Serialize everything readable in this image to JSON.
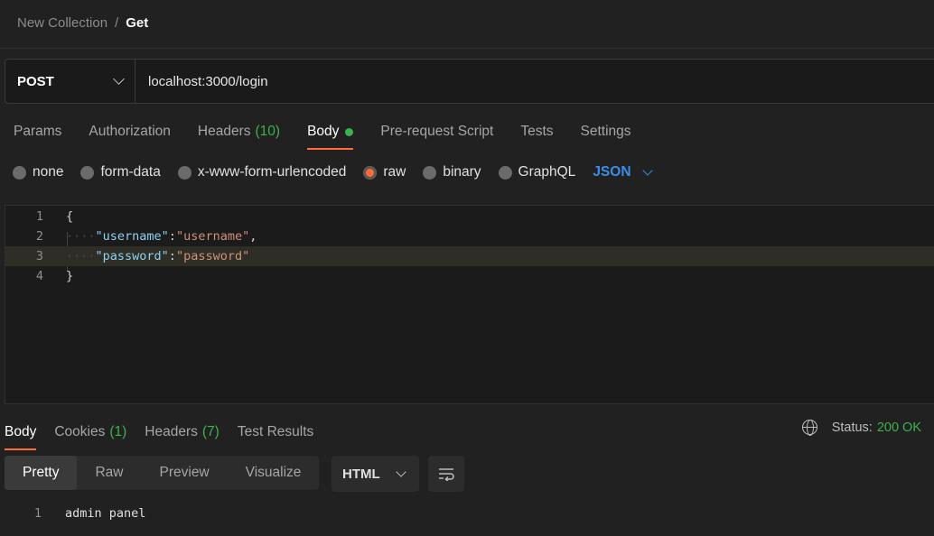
{
  "breadcrumb": {
    "parent": "New Collection",
    "separator": "/",
    "current": "Get"
  },
  "request": {
    "method": "POST",
    "url": "localhost:3000/login"
  },
  "request_tabs": [
    {
      "label": "Params"
    },
    {
      "label": "Authorization"
    },
    {
      "label": "Headers",
      "count": "(10)"
    },
    {
      "label": "Body",
      "active": true
    },
    {
      "label": "Pre-request Script"
    },
    {
      "label": "Tests"
    },
    {
      "label": "Settings"
    }
  ],
  "body_types": [
    {
      "label": "none"
    },
    {
      "label": "form-data"
    },
    {
      "label": "x-www-form-urlencoded"
    },
    {
      "label": "raw",
      "selected": true
    },
    {
      "label": "binary"
    },
    {
      "label": "GraphQL"
    }
  ],
  "body_format": "JSON",
  "editor": {
    "lines": [
      {
        "num": "1",
        "text": "{"
      },
      {
        "num": "2",
        "key": "\"username\"",
        "value": "\"username\"",
        "trail": ","
      },
      {
        "num": "3",
        "key": "\"password\"",
        "value": "\"password\"",
        "trail": ""
      },
      {
        "num": "4",
        "text": "}"
      }
    ]
  },
  "response_tabs": [
    {
      "label": "Body",
      "active": true
    },
    {
      "label": "Cookies",
      "count": "(1)"
    },
    {
      "label": "Headers",
      "count": "(7)"
    },
    {
      "label": "Test Results"
    }
  ],
  "status": {
    "label": "Status:",
    "value": "200 OK"
  },
  "view_modes": [
    {
      "label": "Pretty",
      "active": true
    },
    {
      "label": "Raw"
    },
    {
      "label": "Preview"
    },
    {
      "label": "Visualize"
    }
  ],
  "response_format": "HTML",
  "response_body": {
    "num": "1",
    "text": "admin panel"
  },
  "colors": {
    "accent": "#ff6c37",
    "success": "#3fb04f",
    "link": "#3b8ee8"
  },
  "icons": [
    "chevron-down-icon",
    "globe-icon",
    "wrap-lines-icon"
  ]
}
